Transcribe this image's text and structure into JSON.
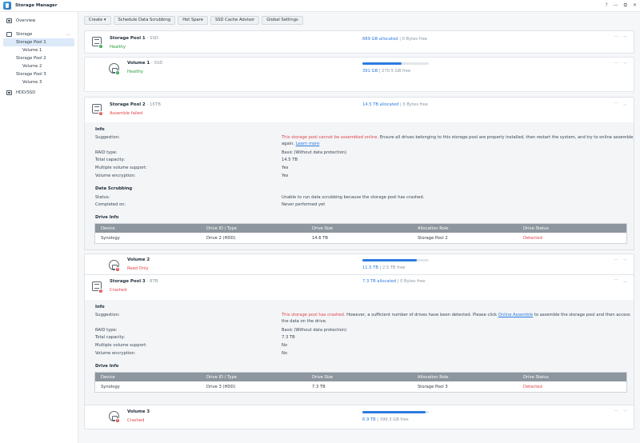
{
  "app": {
    "title": "Storage Manager",
    "controls": [
      "?",
      "—",
      "⧉",
      "✕"
    ]
  },
  "sidebar": {
    "overview": "Overview",
    "storage": "Storage",
    "items": [
      {
        "label": "Storage Pool 1",
        "level": 1,
        "active": true
      },
      {
        "label": "Volume 1",
        "level": 2
      },
      {
        "label": "Storage Pool 2",
        "level": 1
      },
      {
        "label": "Volume 2",
        "level": 2
      },
      {
        "label": "Storage Pool 3",
        "level": 1
      },
      {
        "label": "Volume 3",
        "level": 2
      }
    ],
    "hdd": "HDD/SSD"
  },
  "toolbar": {
    "create": "Create ▾",
    "schedule": "Schedule Data Scrubbing",
    "hotspare": "Hot Spare",
    "cache": "SSD Cache Advisor",
    "global": "Global Settings"
  },
  "pool1": {
    "name": "Storage Pool 1",
    "sub": " - SSD",
    "status": "Healthy",
    "allocated": "689 GB allocated",
    "free": " | 0 Bytes free"
  },
  "vol1": {
    "name": "Volume 1",
    "sub": " - SSD",
    "status": "Healthy",
    "used": "391 GB",
    "total": " | 270.5 GB free",
    "fill_percent": 59
  },
  "pool2": {
    "name": "Storage Pool 2",
    "sub": " - 16TB",
    "status": "Assemble failed",
    "allocated": "14.5 TB allocated",
    "free": " | 0 Bytes free",
    "info_title": "Info",
    "suggestion_label": "Suggestion:",
    "suggestion_red": "This storage pool cannot be assembled online.",
    "suggestion_text": " Ensure all drives belonging to this storage pool are properly installed, then restart the system, and try to online assemble again. ",
    "learn_more": "Learn more",
    "raid_label": "RAID type:",
    "raid": "Basic (Without data protection)",
    "capacity_label": "Total capacity:",
    "capacity": "14.5 TB",
    "multi_label": "Multiple volume support:",
    "multi": "Yes",
    "enc_label": "Volume encryption:",
    "enc": "Yes",
    "scrub_title": "Data Scrubbing",
    "status_label": "Status:",
    "scrub_status": "Unable to run data scrubbing because the storage pool has crashed.",
    "completed_label": "Completed on:",
    "completed": "Never performed yet",
    "drive_title": "Drive Info",
    "drive_row": {
      "device": "Synology",
      "id": "Drive 2 (HDD)",
      "size": "14.6 TB",
      "role": "Storage Pool 2",
      "status": "Detected"
    }
  },
  "vol2": {
    "name": "Volume 2",
    "status": "Read Only",
    "used": "11.5 TB",
    "total": " | 2.5 TB free",
    "fill_percent": 82
  },
  "pool3": {
    "name": "Storage Pool 3",
    "sub": " - 8TB",
    "status": "Crashed",
    "allocated": "7.3 TB allocated",
    "free": " | 0 Bytes free",
    "info_title": "Info",
    "suggestion_label": "Suggestion:",
    "suggestion_red": "This storage pool has crashed.",
    "suggestion_text1": " However, a sufficient number of drives have been detected. Please click ",
    "online_assemble": "Online Assemble",
    "suggestion_text2": " to assemble the storage pool and then access the data on the drive.",
    "raid_label": "RAID type:",
    "raid": "Basic (Without data protection)",
    "capacity_label": "Total capacity:",
    "capacity": "7.3 TB",
    "multi_label": "Multiple volume support:",
    "multi": "No",
    "enc_label": "Volume encryption:",
    "enc": "No",
    "drive_title": "Drive Info",
    "drive_row": {
      "device": "Synology",
      "id": "Drive 3 (HDD)",
      "size": "7.3 TB",
      "role": "Storage Pool 3",
      "status": "Detected"
    }
  },
  "vol3": {
    "name": "Volume 3",
    "status": "Crashed",
    "used": "6.9 TB",
    "total": " | 399.3 GB free",
    "fill_percent": 95
  },
  "drive_headers": [
    "Device",
    "Drive ID / Type",
    "Drive Size",
    "Allocation Role",
    "Drive Status"
  ],
  "colors": {
    "accent": "#2c7be0",
    "healthy": "#2a9d3f",
    "error": "#e0434a"
  }
}
